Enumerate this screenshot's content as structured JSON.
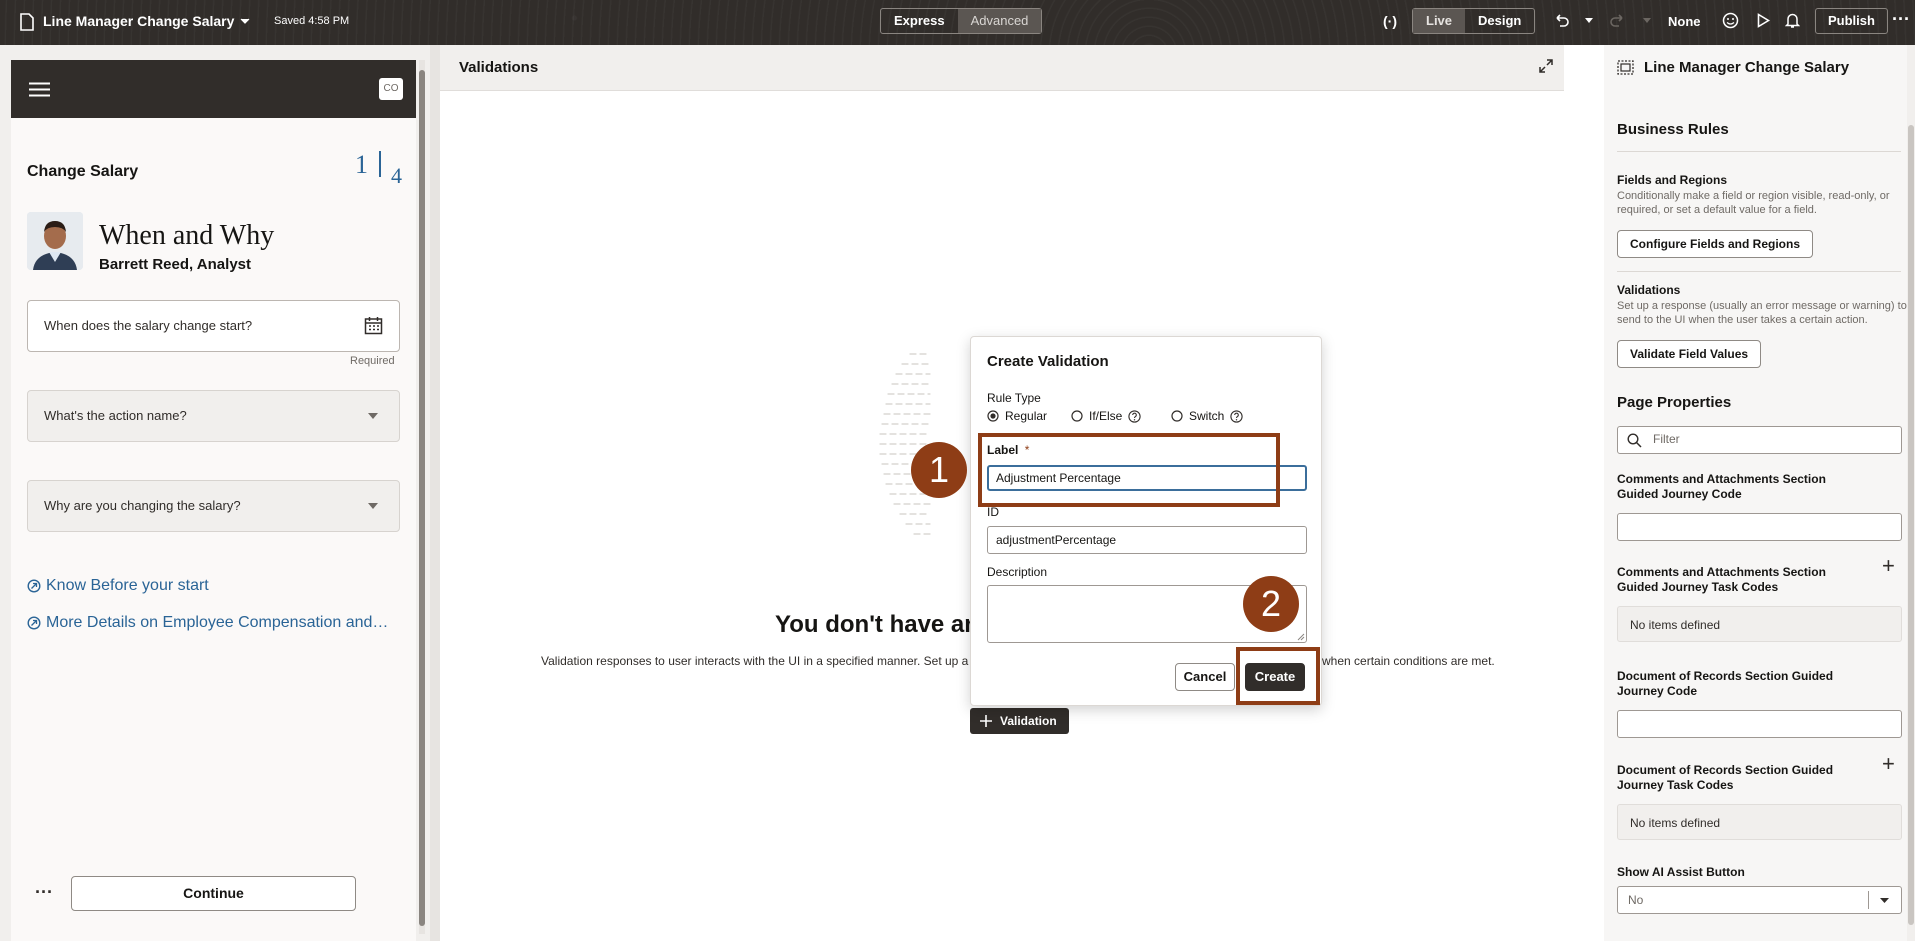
{
  "topbar": {
    "page_title": "Line Manager Change Salary",
    "saved_status": "Saved 4:58 PM",
    "mode_express": "Express",
    "mode_advanced": "Advanced",
    "view_live": "Live",
    "view_design": "Design",
    "zoom_none": "None",
    "publish_label": "Publish"
  },
  "preview": {
    "avatar_initials": "CO",
    "flow_title": "Change Salary",
    "step_current": "1",
    "step_total": "4",
    "heading": "When and Why",
    "employee": "Barrett Reed, Analyst",
    "date_placeholder": "When does the salary change start?",
    "required_text": "Required",
    "action_placeholder": "What's the action name?",
    "reason_placeholder": "Why are you changing the salary?",
    "link_know": "Know Before your start",
    "link_more": "More Details on Employee Compensation and…",
    "more_label": "···",
    "continue_label": "Continue"
  },
  "validations": {
    "panel_title": "Validations",
    "empty_heading_visible": "You don't have ar",
    "empty_desc_left": "Validation responses to user interacts with the UI in a specified manner. Set up a",
    "empty_desc_right": "when certain conditions are met.",
    "add_button": "Validation"
  },
  "dialog": {
    "title": "Create Validation",
    "rule_type_label": "Rule Type",
    "options": [
      "Regular",
      "If/Else",
      "Switch"
    ],
    "selected_option": "Regular",
    "label_label": "Label",
    "required_marker": "*",
    "label_value": "Adjustment Percentage",
    "id_label": "ID",
    "id_value": "adjustmentPercentage",
    "description_label": "Description",
    "description_value": "",
    "cancel_label": "Cancel",
    "create_label": "Create"
  },
  "callouts": {
    "step1": "1",
    "step2": "2"
  },
  "properties": {
    "title": "Line Manager Change Salary",
    "business_rules": "Business Rules",
    "fields_regions_title": "Fields and Regions",
    "fields_regions_desc": "Conditionally make a field or region visible, read-only, or required, or set a default value for a field.",
    "configure_button": "Configure Fields and Regions",
    "validations_title": "Validations",
    "validations_desc": "Set up a response (usually an error message or warning) to send to the UI when the user takes a certain action.",
    "validate_button": "Validate Field Values",
    "page_properties": "Page Properties",
    "filter_placeholder": "Filter",
    "comments_code_label": "Comments and Attachments Section Guided Journey Code",
    "comments_task_label": "Comments and Attachments Section Guided Journey Task Codes",
    "no_items_1": "No items defined",
    "doc_code_label": "Document of Records Section Guided Journey Code",
    "doc_task_label": "Document of Records Section Guided Journey Task Codes",
    "no_items_2": "No items defined",
    "ai_assist_label": "Show AI Assist Button",
    "ai_assist_value": "No"
  },
  "colors": {
    "header_dark": "#312d2a",
    "callout": "#8e3d16",
    "link": "#2a6496"
  }
}
